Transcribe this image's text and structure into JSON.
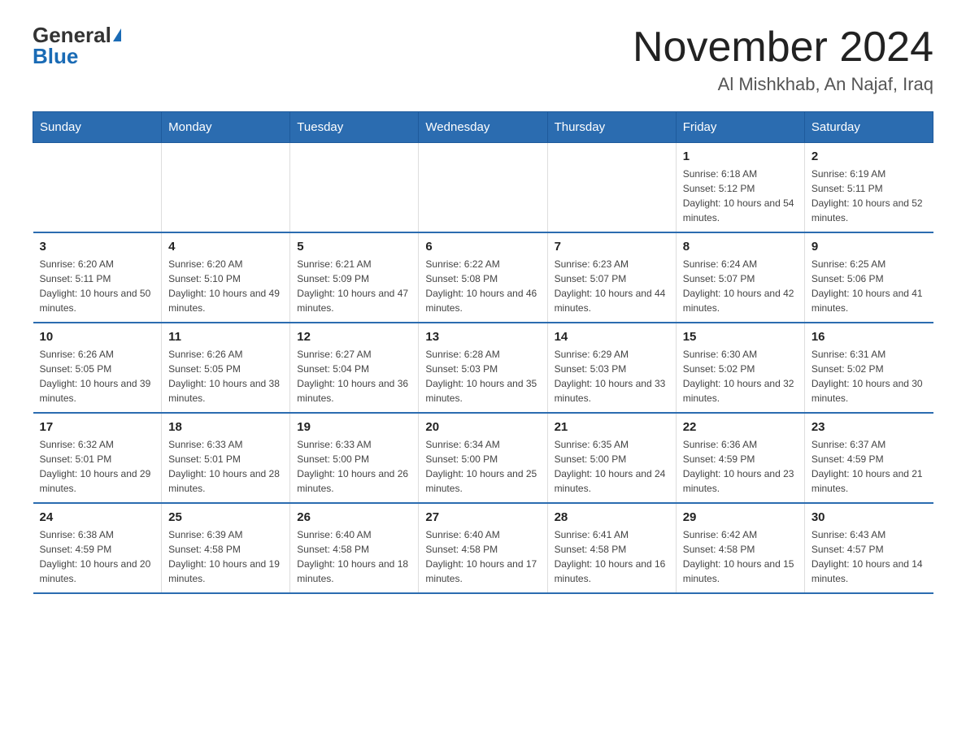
{
  "header": {
    "logo_general": "General",
    "logo_blue": "Blue",
    "title": "November 2024",
    "subtitle": "Al Mishkhab, An Najaf, Iraq"
  },
  "weekdays": [
    "Sunday",
    "Monday",
    "Tuesday",
    "Wednesday",
    "Thursday",
    "Friday",
    "Saturday"
  ],
  "weeks": [
    [
      {
        "day": "",
        "info": ""
      },
      {
        "day": "",
        "info": ""
      },
      {
        "day": "",
        "info": ""
      },
      {
        "day": "",
        "info": ""
      },
      {
        "day": "",
        "info": ""
      },
      {
        "day": "1",
        "info": "Sunrise: 6:18 AM\nSunset: 5:12 PM\nDaylight: 10 hours and 54 minutes."
      },
      {
        "day": "2",
        "info": "Sunrise: 6:19 AM\nSunset: 5:11 PM\nDaylight: 10 hours and 52 minutes."
      }
    ],
    [
      {
        "day": "3",
        "info": "Sunrise: 6:20 AM\nSunset: 5:11 PM\nDaylight: 10 hours and 50 minutes."
      },
      {
        "day": "4",
        "info": "Sunrise: 6:20 AM\nSunset: 5:10 PM\nDaylight: 10 hours and 49 minutes."
      },
      {
        "day": "5",
        "info": "Sunrise: 6:21 AM\nSunset: 5:09 PM\nDaylight: 10 hours and 47 minutes."
      },
      {
        "day": "6",
        "info": "Sunrise: 6:22 AM\nSunset: 5:08 PM\nDaylight: 10 hours and 46 minutes."
      },
      {
        "day": "7",
        "info": "Sunrise: 6:23 AM\nSunset: 5:07 PM\nDaylight: 10 hours and 44 minutes."
      },
      {
        "day": "8",
        "info": "Sunrise: 6:24 AM\nSunset: 5:07 PM\nDaylight: 10 hours and 42 minutes."
      },
      {
        "day": "9",
        "info": "Sunrise: 6:25 AM\nSunset: 5:06 PM\nDaylight: 10 hours and 41 minutes."
      }
    ],
    [
      {
        "day": "10",
        "info": "Sunrise: 6:26 AM\nSunset: 5:05 PM\nDaylight: 10 hours and 39 minutes."
      },
      {
        "day": "11",
        "info": "Sunrise: 6:26 AM\nSunset: 5:05 PM\nDaylight: 10 hours and 38 minutes."
      },
      {
        "day": "12",
        "info": "Sunrise: 6:27 AM\nSunset: 5:04 PM\nDaylight: 10 hours and 36 minutes."
      },
      {
        "day": "13",
        "info": "Sunrise: 6:28 AM\nSunset: 5:03 PM\nDaylight: 10 hours and 35 minutes."
      },
      {
        "day": "14",
        "info": "Sunrise: 6:29 AM\nSunset: 5:03 PM\nDaylight: 10 hours and 33 minutes."
      },
      {
        "day": "15",
        "info": "Sunrise: 6:30 AM\nSunset: 5:02 PM\nDaylight: 10 hours and 32 minutes."
      },
      {
        "day": "16",
        "info": "Sunrise: 6:31 AM\nSunset: 5:02 PM\nDaylight: 10 hours and 30 minutes."
      }
    ],
    [
      {
        "day": "17",
        "info": "Sunrise: 6:32 AM\nSunset: 5:01 PM\nDaylight: 10 hours and 29 minutes."
      },
      {
        "day": "18",
        "info": "Sunrise: 6:33 AM\nSunset: 5:01 PM\nDaylight: 10 hours and 28 minutes."
      },
      {
        "day": "19",
        "info": "Sunrise: 6:33 AM\nSunset: 5:00 PM\nDaylight: 10 hours and 26 minutes."
      },
      {
        "day": "20",
        "info": "Sunrise: 6:34 AM\nSunset: 5:00 PM\nDaylight: 10 hours and 25 minutes."
      },
      {
        "day": "21",
        "info": "Sunrise: 6:35 AM\nSunset: 5:00 PM\nDaylight: 10 hours and 24 minutes."
      },
      {
        "day": "22",
        "info": "Sunrise: 6:36 AM\nSunset: 4:59 PM\nDaylight: 10 hours and 23 minutes."
      },
      {
        "day": "23",
        "info": "Sunrise: 6:37 AM\nSunset: 4:59 PM\nDaylight: 10 hours and 21 minutes."
      }
    ],
    [
      {
        "day": "24",
        "info": "Sunrise: 6:38 AM\nSunset: 4:59 PM\nDaylight: 10 hours and 20 minutes."
      },
      {
        "day": "25",
        "info": "Sunrise: 6:39 AM\nSunset: 4:58 PM\nDaylight: 10 hours and 19 minutes."
      },
      {
        "day": "26",
        "info": "Sunrise: 6:40 AM\nSunset: 4:58 PM\nDaylight: 10 hours and 18 minutes."
      },
      {
        "day": "27",
        "info": "Sunrise: 6:40 AM\nSunset: 4:58 PM\nDaylight: 10 hours and 17 minutes."
      },
      {
        "day": "28",
        "info": "Sunrise: 6:41 AM\nSunset: 4:58 PM\nDaylight: 10 hours and 16 minutes."
      },
      {
        "day": "29",
        "info": "Sunrise: 6:42 AM\nSunset: 4:58 PM\nDaylight: 10 hours and 15 minutes."
      },
      {
        "day": "30",
        "info": "Sunrise: 6:43 AM\nSunset: 4:57 PM\nDaylight: 10 hours and 14 minutes."
      }
    ]
  ]
}
